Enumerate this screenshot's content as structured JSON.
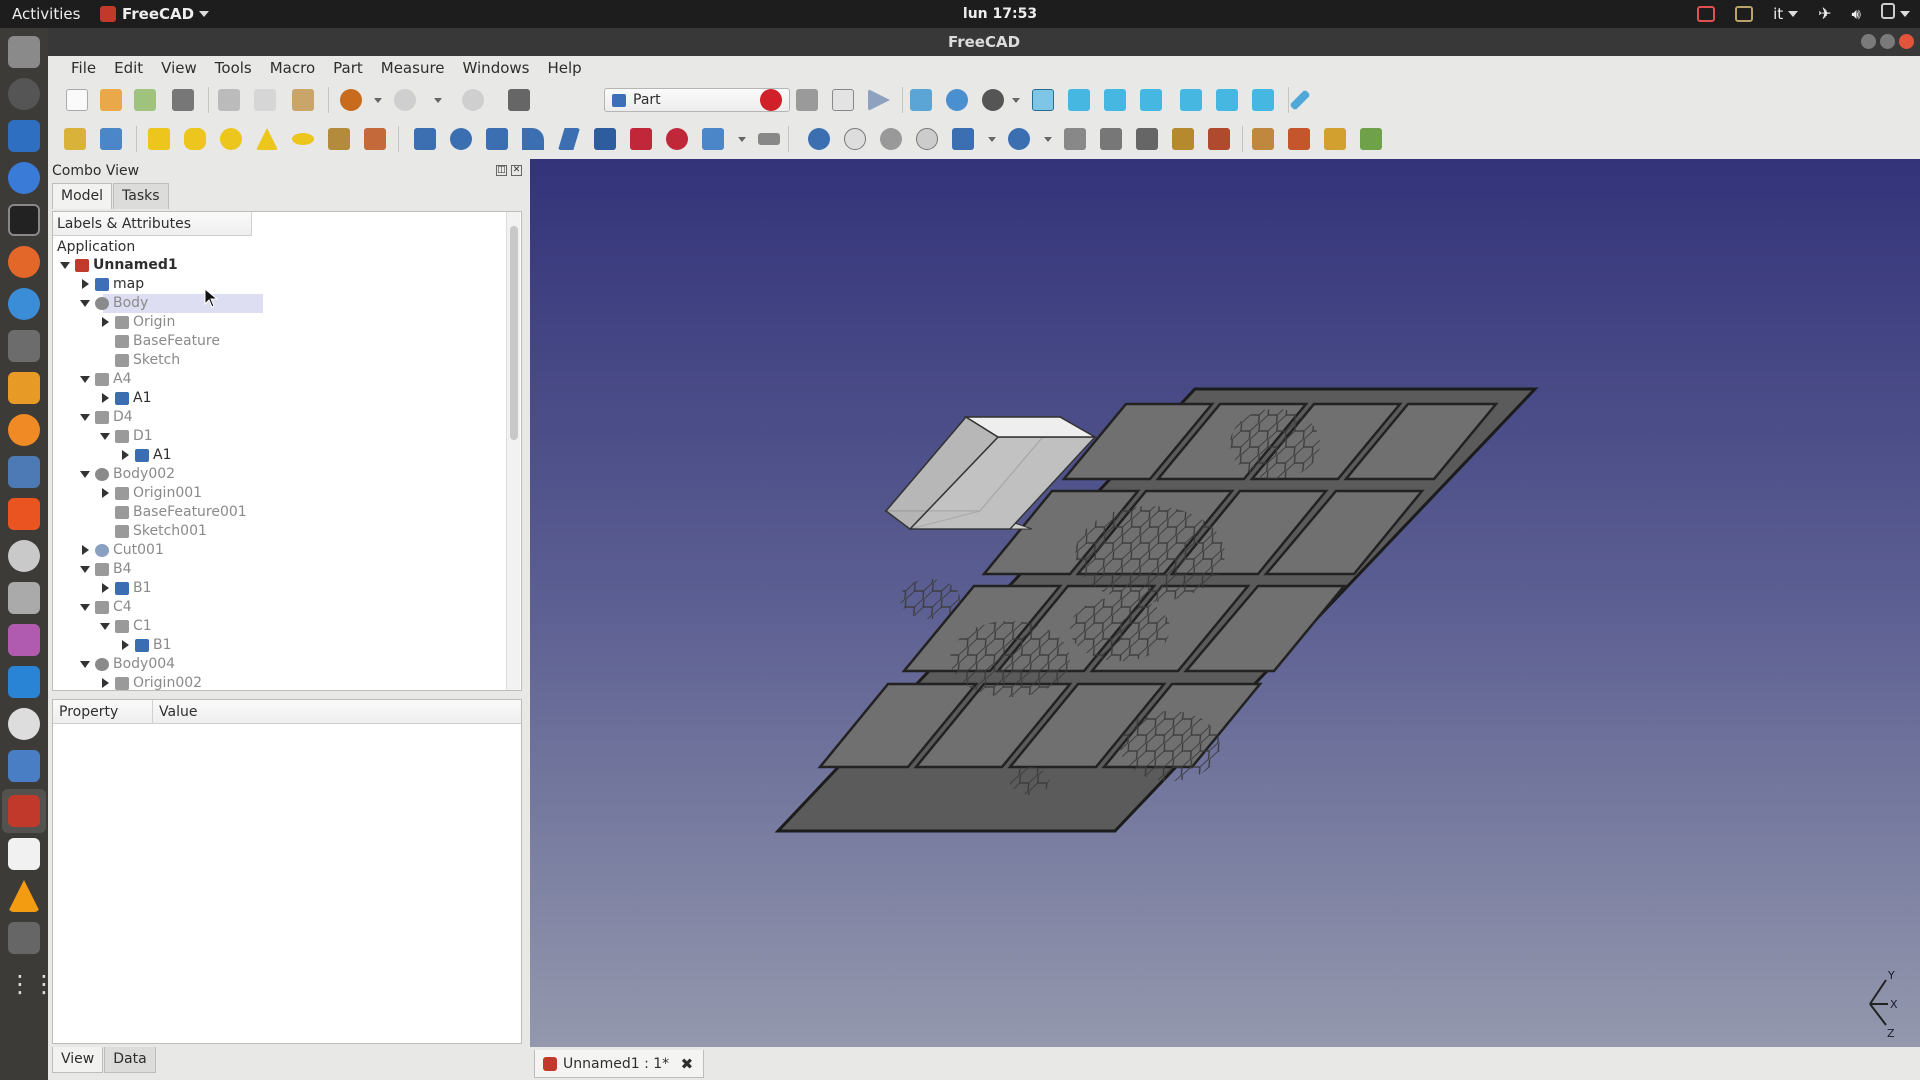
{
  "topbar": {
    "activities": "Activities",
    "app_name": "FreeCAD",
    "clock": "lun 17:53",
    "keyboard_layout": "it"
  },
  "window": {
    "title": "FreeCAD"
  },
  "menu": {
    "items": [
      "File",
      "Edit",
      "View",
      "Tools",
      "Macro",
      "Part",
      "Measure",
      "Windows",
      "Help"
    ]
  },
  "toolbar": {
    "workbench": "Part"
  },
  "combo": {
    "title": "Combo View",
    "tabs": [
      "Model",
      "Tasks"
    ],
    "tree_header": "Labels & Attributes",
    "application": "Application",
    "tree": [
      {
        "label": "Unnamed1",
        "depth": 0,
        "expanded": true,
        "style": "bold",
        "icon": "document-icon"
      },
      {
        "label": "map",
        "depth": 1,
        "expanded": false,
        "style": "normal",
        "icon": "part-icon"
      },
      {
        "label": "Body",
        "depth": 1,
        "expanded": true,
        "style": "dim",
        "icon": "body-icon"
      },
      {
        "label": "Origin",
        "depth": 2,
        "expanded": false,
        "style": "dim",
        "icon": "origin-icon"
      },
      {
        "label": "BaseFeature",
        "depth": 2,
        "expanded": null,
        "style": "dim",
        "icon": "basefeature-icon"
      },
      {
        "label": "Sketch",
        "depth": 2,
        "expanded": null,
        "style": "dim",
        "icon": "sketch-icon"
      },
      {
        "label": "A4",
        "depth": 1,
        "expanded": true,
        "style": "dim",
        "icon": "compound-icon"
      },
      {
        "label": "A1",
        "depth": 2,
        "expanded": false,
        "style": "normal",
        "icon": "shape-icon"
      },
      {
        "label": "D4",
        "depth": 1,
        "expanded": true,
        "style": "dim",
        "icon": "compound-icon"
      },
      {
        "label": "D1",
        "depth": 2,
        "expanded": true,
        "style": "dim",
        "icon": "compound-icon"
      },
      {
        "label": "A1",
        "depth": 3,
        "expanded": false,
        "style": "normal",
        "icon": "shape-icon"
      },
      {
        "label": "Body002",
        "depth": 1,
        "expanded": true,
        "style": "dim",
        "icon": "body-icon"
      },
      {
        "label": "Origin001",
        "depth": 2,
        "expanded": false,
        "style": "dim",
        "icon": "origin-icon"
      },
      {
        "label": "BaseFeature001",
        "depth": 2,
        "expanded": null,
        "style": "dim",
        "icon": "basefeature-icon"
      },
      {
        "label": "Sketch001",
        "depth": 2,
        "expanded": null,
        "style": "dim",
        "icon": "sketch-icon"
      },
      {
        "label": "Cut001",
        "depth": 1,
        "expanded": false,
        "style": "dim",
        "icon": "cut-icon"
      },
      {
        "label": "B4",
        "depth": 1,
        "expanded": true,
        "style": "dim",
        "icon": "compound-icon"
      },
      {
        "label": "B1",
        "depth": 2,
        "expanded": false,
        "style": "dim",
        "icon": "shape-icon"
      },
      {
        "label": "C4",
        "depth": 1,
        "expanded": true,
        "style": "dim",
        "icon": "compound-icon"
      },
      {
        "label": "C1",
        "depth": 2,
        "expanded": true,
        "style": "dim",
        "icon": "compound-icon"
      },
      {
        "label": "B1",
        "depth": 3,
        "expanded": false,
        "style": "dim",
        "icon": "shape-icon"
      },
      {
        "label": "Body004",
        "depth": 1,
        "expanded": true,
        "style": "dim",
        "icon": "body-icon"
      },
      {
        "label": "Origin002",
        "depth": 2,
        "expanded": false,
        "style": "dim",
        "icon": "origin-icon"
      }
    ],
    "property_columns": [
      "Property",
      "Value"
    ],
    "bottom_tabs": [
      "View",
      "Data"
    ]
  },
  "document_tab": {
    "label": "Unnamed1 : 1*"
  },
  "axis": {
    "labels": [
      "Y",
      "X",
      "Z"
    ]
  },
  "colors": {
    "view_top": "#33337a",
    "view_bottom": "#9498ad",
    "selection": "#dedef3",
    "freecad_red": "#c0392b"
  }
}
